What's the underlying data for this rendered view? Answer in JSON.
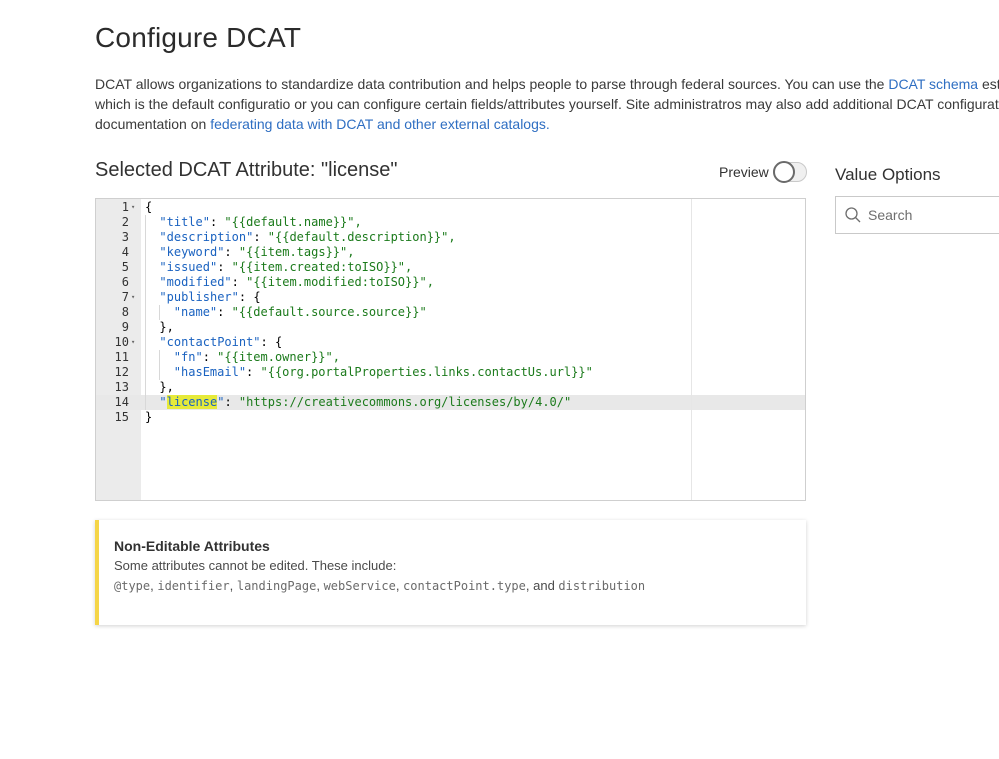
{
  "page": {
    "title": "Configure DCAT",
    "intro": {
      "line1_a": "DCAT allows organizations to standardize data contribution and helps people to parse through federal sources. You can use the ",
      "link_schema": "DCAT schema",
      "line1_b": " establis",
      "line2": "which is the default configuratio or you can configure certain fields/attributes yourself. Site administratros may also add additional DCAT configuration",
      "line3_a": "documentation on ",
      "link_federating": "federating data with DCAT and other external catalogs."
    }
  },
  "editor": {
    "section_title": "Selected DCAT Attribute: \"license\"",
    "preview_label": "Preview",
    "preview_on": false,
    "lines": [
      {
        "n": "1",
        "fold": true,
        "text": "{"
      },
      {
        "n": "2",
        "key": "\"title\"",
        "val": "\"{{default.name}}\","
      },
      {
        "n": "3",
        "key": "\"description\"",
        "val": "\"{{default.description}}\","
      },
      {
        "n": "4",
        "key": "\"keyword\"",
        "val": "\"{{item.tags}}\","
      },
      {
        "n": "5",
        "key": "\"issued\"",
        "val": "\"{{item.created:toISO}}\","
      },
      {
        "n": "6",
        "key": "\"modified\"",
        "val": "\"{{item.modified:toISO}}\","
      },
      {
        "n": "7",
        "fold": true,
        "key": "\"publisher\"",
        "val": "{"
      },
      {
        "n": "8",
        "key": "\"name\"",
        "val": "\"{{default.source.source}}\""
      },
      {
        "n": "9",
        "text": "},"
      },
      {
        "n": "10",
        "fold": true,
        "key": "\"contactPoint\"",
        "val": "{"
      },
      {
        "n": "11",
        "key": "\"fn\"",
        "val": "\"{{item.owner}}\","
      },
      {
        "n": "12",
        "key": "\"hasEmail\"",
        "val": "\"{{org.portalProperties.links.contactUs.url}}\""
      },
      {
        "n": "13",
        "text": "},"
      },
      {
        "n": "14",
        "key_pre": "\"",
        "key_hl": "license",
        "key_post": "\"",
        "val": "\"https://creativecommons.org/licenses/by/4.0/\""
      },
      {
        "n": "15",
        "text": "}"
      }
    ],
    "active_line": "14"
  },
  "notice": {
    "title": "Non-Editable Attributes",
    "text": "Some attributes cannot be edited. These include:",
    "attributes": [
      "@type",
      "identifier",
      "landingPage",
      "webService",
      "contactPoint.type"
    ],
    "last_attribute": "distribution",
    "and_word": "and",
    "accent_color": "#f5d547"
  },
  "value_options": {
    "title": "Value Options",
    "search_placeholder": "Search",
    "search_icon": "search-icon"
  }
}
